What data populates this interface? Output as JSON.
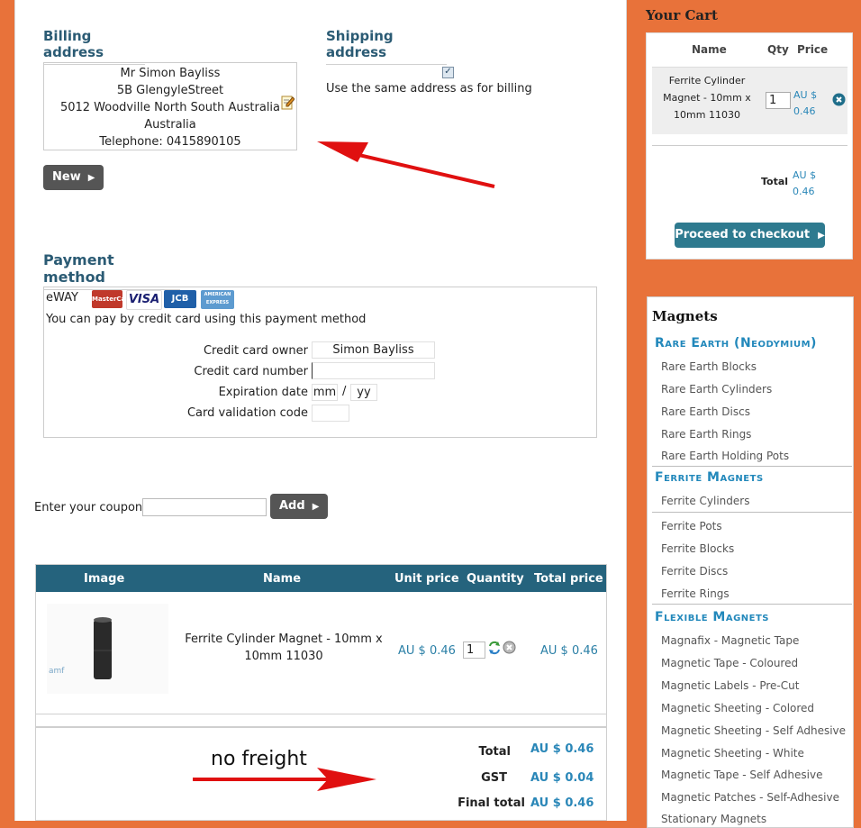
{
  "billing": {
    "title": "Billing address",
    "name": "Mr Simon Bayliss",
    "street": "5B GlengyleStreet",
    "city": "5012 Woodville North South Australia",
    "country": "Australia",
    "telephone": "Telephone: 0415890105",
    "new_button": "New"
  },
  "shipping": {
    "title": "Shipping address",
    "same_label": "Use the same address as for billing"
  },
  "payment": {
    "title": "Payment method",
    "provider": "eWAY",
    "description": "You can pay by credit card using this payment method",
    "owner_label": "Credit card owner",
    "owner_value": "Simon Bayliss",
    "number_label": "Credit card number",
    "expiry_label": "Expiration date",
    "expiry_mm": "mm",
    "expiry_sep": "/",
    "expiry_yy": "yy",
    "cvc_label": "Card validation code",
    "cards": [
      "MasterCard",
      "VISA",
      "JCB",
      "AMERICAN EXPRESS"
    ]
  },
  "coupon": {
    "label": "Enter your coupon",
    "add_button": "Add"
  },
  "table": {
    "headers": [
      "Image",
      "Name",
      "Unit price",
      "Quantity",
      "Total price"
    ],
    "row": {
      "name_line1": "Ferrite Cylinder Magnet - 10mm x",
      "name_line2": "10mm 11030",
      "unit_price": "AU $ 0.46",
      "quantity": "1",
      "total_price": "AU $ 0.46",
      "logo_text": "amf"
    },
    "total_label": "Total",
    "total_value": "AU $ 0.46",
    "gst_label": "GST",
    "gst_value": "AU $ 0.04",
    "final_label": "Final total",
    "final_value": "AU $ 0.46"
  },
  "annotation": {
    "no_freight": "no freight"
  },
  "cart": {
    "title": "Your Cart",
    "headers": [
      "Name",
      "Qty",
      "Price"
    ],
    "item_line1": "Ferrite Cylinder",
    "item_line2": "Magnet - 10mm x",
    "item_line3": "10mm 11030",
    "qty": "1",
    "price_line1": "AU $",
    "price_line2": "0.46",
    "total_label": "Total",
    "total_line1": "AU $",
    "total_line2": "0.46",
    "proceed_button": "Proceed to checkout"
  },
  "menu": {
    "title": "Magnets",
    "sections": [
      {
        "head": "Rare Earth (Neodymium)",
        "items": [
          "Rare Earth Blocks",
          "Rare Earth Cylinders",
          "Rare Earth Discs",
          "Rare Earth Rings",
          "Rare Earth Holding Pots"
        ]
      },
      {
        "head": "Ferrite Magnets",
        "items": [
          "Ferrite Cylinders",
          "Ferrite Pots",
          "Ferrite Blocks",
          "Ferrite Discs",
          "Ferrite Rings"
        ]
      },
      {
        "head": "Flexible Magnets",
        "items": [
          "Magnafix - Magnetic Tape",
          "Magnetic Tape - Coloured",
          "Magnetic Labels - Pre-Cut",
          "Magnetic Sheeting - Colored",
          "Magnetic Sheeting - Self Adhesive",
          "Magnetic Sheeting - White",
          "Magnetic Tape - Self Adhesive",
          "Magnetic Patches - Self-Adhesive",
          "Stationary Magnets"
        ]
      }
    ]
  },
  "colors": {
    "orange": "#e8723a",
    "header_blue": "#25637d",
    "link_blue": "#2288bb"
  }
}
